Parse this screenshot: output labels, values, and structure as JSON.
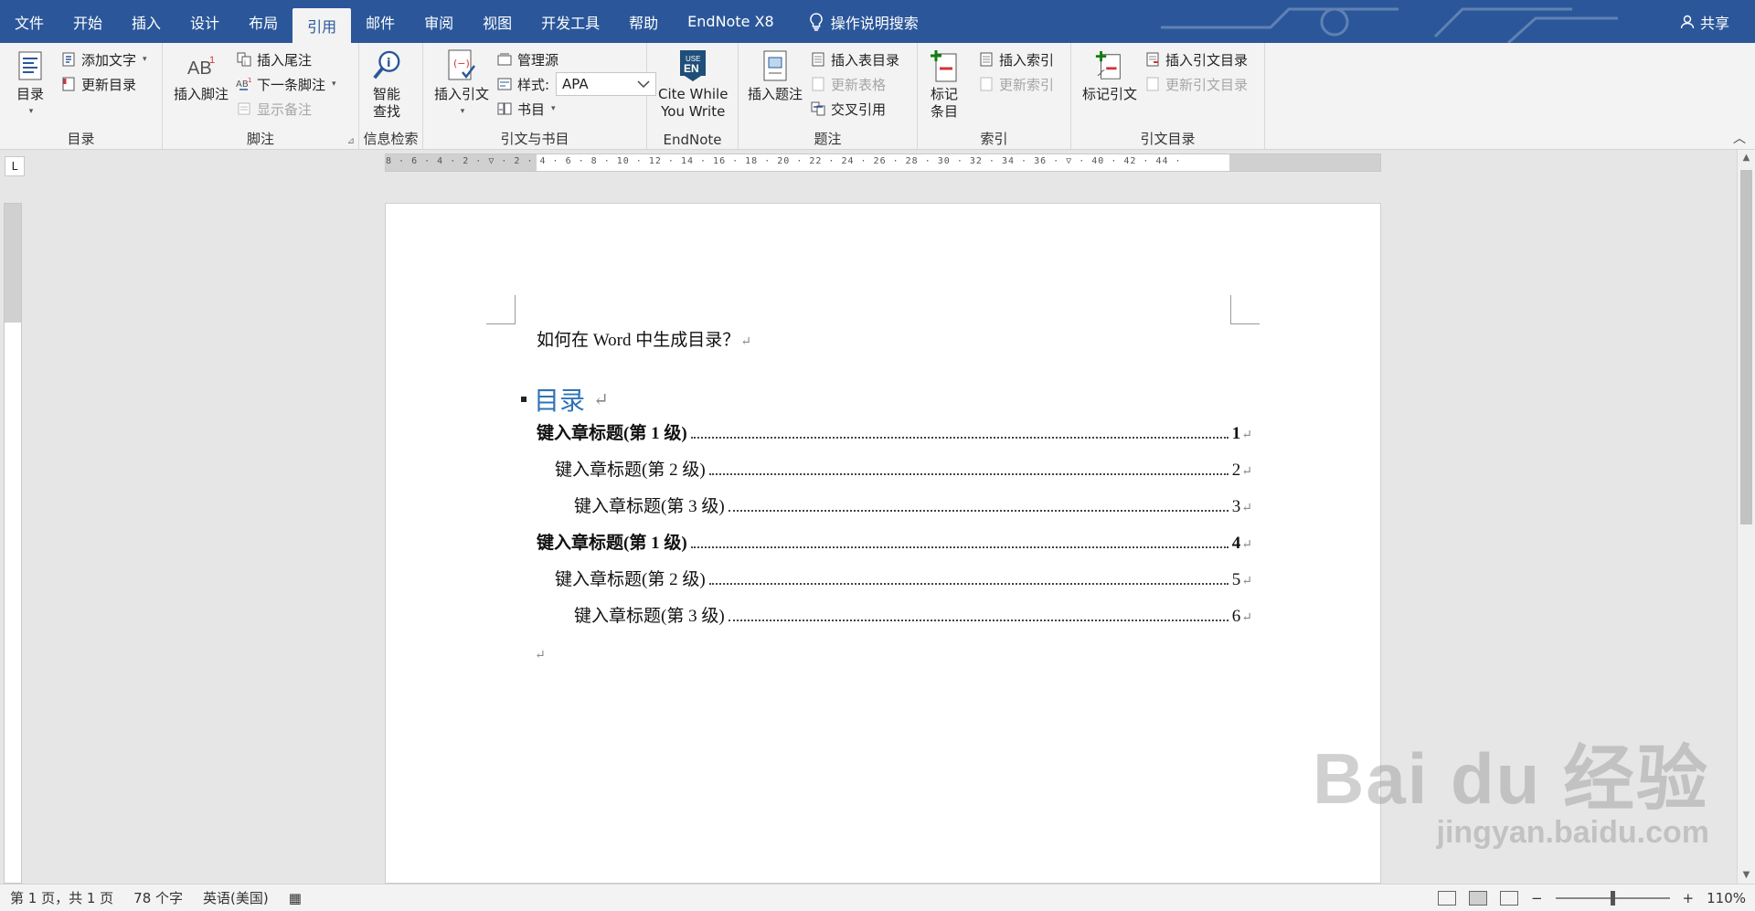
{
  "menu": {
    "tabs": [
      "文件",
      "开始",
      "插入",
      "设计",
      "布局",
      "引用",
      "邮件",
      "审阅",
      "视图",
      "开发工具",
      "帮助",
      "EndNote X8"
    ],
    "active_tab": "引用",
    "search_label": "操作说明搜索",
    "share_label": "共享"
  },
  "ribbon": {
    "toc": {
      "toc_button": "目录",
      "add_text": "添加文字",
      "update_toc": "更新目录",
      "label": "目录"
    },
    "footnotes": {
      "insert_footnote": "插入脚注",
      "insert_endnote": "插入尾注",
      "next_footnote": "下一条脚注",
      "show_notes": "显示备注",
      "label": "脚注"
    },
    "research": {
      "smart_lookup_1": "智能",
      "smart_lookup_2": "查找",
      "label": "信息检索"
    },
    "citations": {
      "insert_citation": "插入引文",
      "manage_sources": "管理源",
      "style_label": "样式:",
      "style_value": "APA",
      "bibliography": "书目",
      "label": "引文与书目"
    },
    "endnote": {
      "cwyw_1": "Cite While",
      "cwyw_2": "You Write",
      "label": "EndNote"
    },
    "captions": {
      "insert_caption": "插入题注",
      "insert_table_of_figures": "插入表目录",
      "update_table": "更新表格",
      "cross_reference": "交叉引用",
      "label": "题注"
    },
    "index": {
      "mark_entry_1": "标记",
      "mark_entry_2": "条目",
      "insert_index": "插入索引",
      "update_index": "更新索引",
      "label": "索引"
    },
    "toa": {
      "mark_citation": "标记引文",
      "insert_toa": "插入引文目录",
      "update_toa": "更新引文目录",
      "label": "引文目录"
    }
  },
  "ruler": {
    "top_ticks": "8 · 6 · 4 · 2 · ▽ · 2 · 4 · 6 · 8 · 10 · 12 · 14 · 16 · 18 · 20 · 22 · 24 · 26 · 28 · 30 · 32 · 34 · 36 · ▽ · 40 · 42 · 44 ·",
    "corner": "L"
  },
  "document": {
    "title": "如何在 Word 中生成目录？",
    "toc_heading": "目录",
    "entries": [
      {
        "text": "键入章标题(第 1 级)",
        "page": "1",
        "level": 1
      },
      {
        "text": "键入章标题(第 2 级)",
        "page": "2",
        "level": 2
      },
      {
        "text": "键入章标题(第 3 级)",
        "page": "3",
        "level": 3
      },
      {
        "text": "键入章标题(第 1 级)",
        "page": "4",
        "level": 1
      },
      {
        "text": "键入章标题(第 2 级)",
        "page": "5",
        "level": 2
      },
      {
        "text": "键入章标题(第 3 级)",
        "page": "6",
        "level": 3
      }
    ],
    "para_mark": "↵"
  },
  "status": {
    "page": "第 1 页，共 1 页",
    "words": "78 个字",
    "language": "英语(美国)",
    "zoom_minus": "−",
    "zoom_plus": "+",
    "zoom_level": "110%"
  },
  "watermark": {
    "brand": "Bai du 经验",
    "url": "jingyan.baidu.com"
  },
  "colors": {
    "accent": "#2b579a",
    "heading": "#2e74b5"
  }
}
